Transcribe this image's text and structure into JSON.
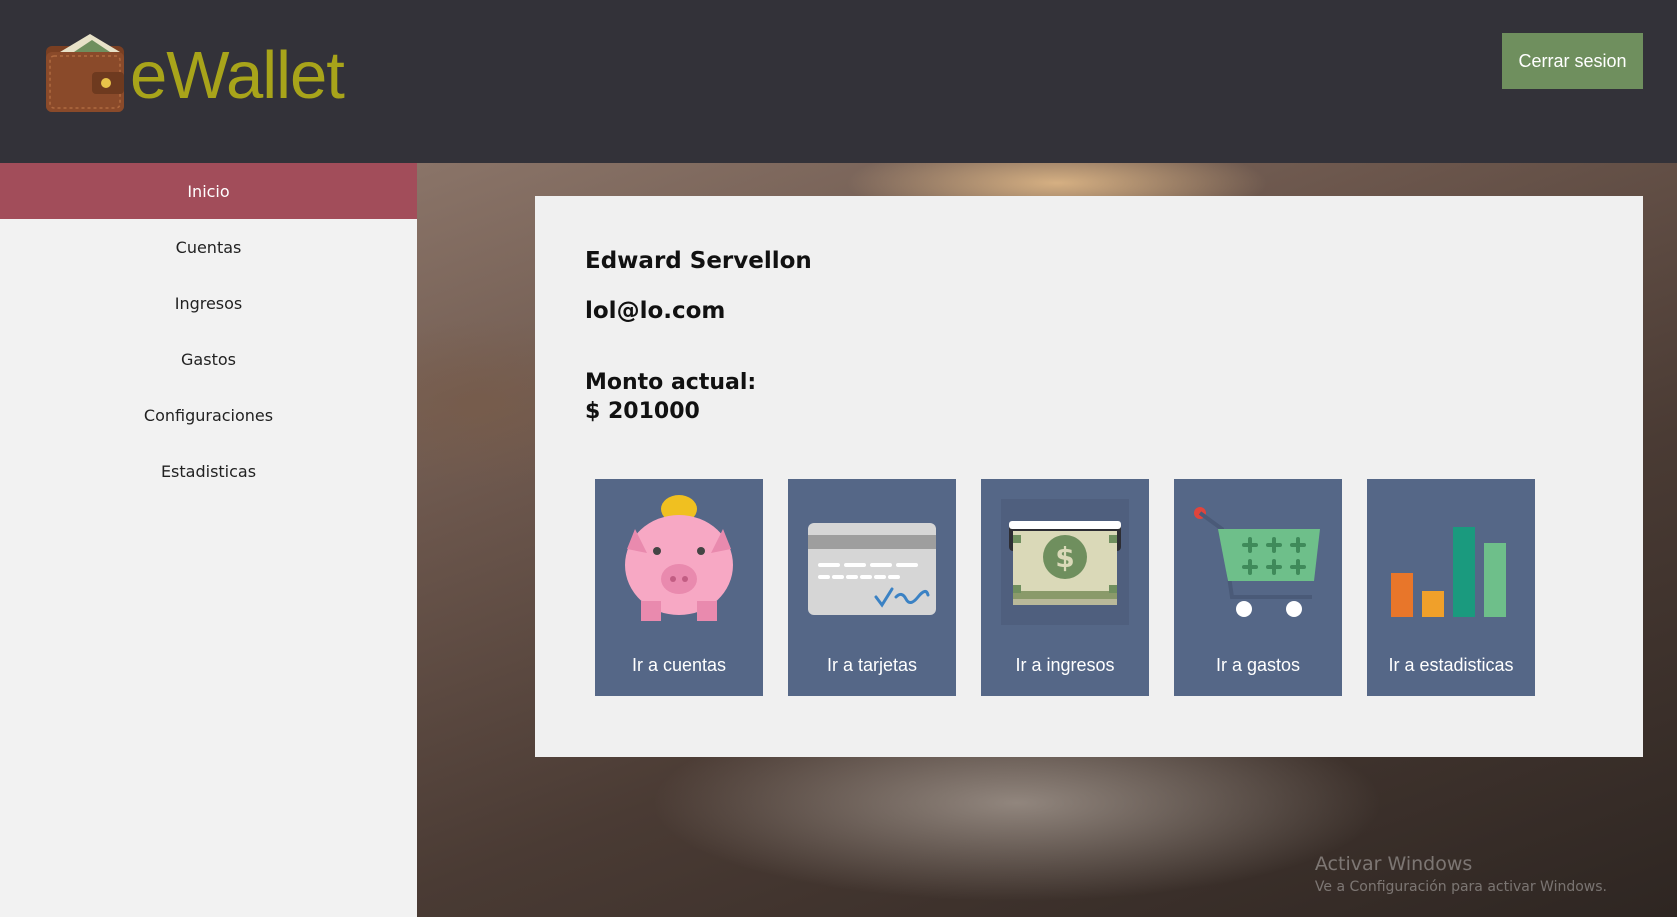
{
  "header": {
    "logo_text": "eWallet",
    "logout_label": "Cerrar sesion"
  },
  "sidebar": {
    "items": [
      {
        "label": "Inicio",
        "active": true
      },
      {
        "label": "Cuentas",
        "active": false
      },
      {
        "label": "Ingresos",
        "active": false
      },
      {
        "label": "Gastos",
        "active": false
      },
      {
        "label": "Configuraciones",
        "active": false
      },
      {
        "label": "Estadisticas",
        "active": false
      }
    ]
  },
  "profile": {
    "name": "Edward Servellon",
    "email": "lol@lo.com",
    "amount_label": "Monto actual:",
    "amount_value": "$ 201000"
  },
  "tiles": [
    {
      "label": "Ir a cuentas",
      "icon": "piggy-bank-icon"
    },
    {
      "label": "Ir a tarjetas",
      "icon": "credit-card-icon"
    },
    {
      "label": "Ir a ingresos",
      "icon": "cash-machine-icon"
    },
    {
      "label": "Ir a gastos",
      "icon": "shopping-cart-icon"
    },
    {
      "label": "Ir a estadisticas",
      "icon": "bar-chart-icon"
    }
  ],
  "watermark": {
    "line1": "Activar Windows",
    "line2": "Ve a Configuración para activar Windows."
  },
  "colors": {
    "header_bg": "#333239",
    "logo_text": "#a8a41a",
    "logout_btn": "#6f8f5e",
    "active_nav": "#a24d5a",
    "tile_bg": "#556787"
  }
}
